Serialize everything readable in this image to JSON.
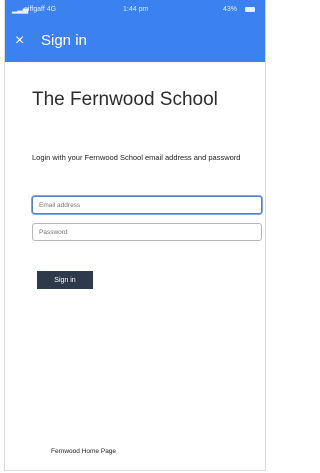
{
  "status_bar": {
    "carrier": "giffgaff 4G",
    "time": "1:44 pm",
    "battery": "43%"
  },
  "header": {
    "close_glyph": "×",
    "title": "Sign in"
  },
  "org_name": "The Fernwood School",
  "intro_text": "Login with your Fernwood School email address and password",
  "form": {
    "email_placeholder": "Email address",
    "password_placeholder": "Password",
    "submit_label": "Sign in"
  },
  "footer_link": "Fernwood Home Page",
  "colors": {
    "header": "#3b82f0",
    "button": "#2e3a4b"
  }
}
